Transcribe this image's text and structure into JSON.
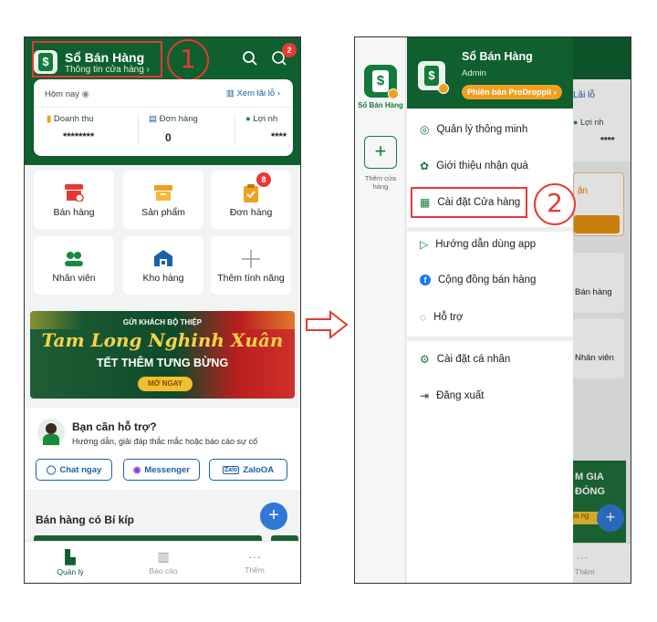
{
  "screen1": {
    "header": {
      "app_name": "Sổ Bán Hàng",
      "store_info": "Thông tin cửa hàng",
      "chat_badge": "2",
      "step": "1"
    },
    "summary": {
      "today": "Hôm nay",
      "view_profit": "Xem lãi lỗ",
      "stats": [
        {
          "label": "Doanh thu",
          "value": "********"
        },
        {
          "label": "Đơn hàng",
          "value": "0"
        },
        {
          "label": "Lợi nh",
          "value": "****"
        }
      ]
    },
    "features": [
      {
        "label": "Bán hàng",
        "icon": "store-icon"
      },
      {
        "label": "Sản phẩm",
        "icon": "box-icon"
      },
      {
        "label": "Đơn hàng",
        "icon": "clipboard-icon",
        "badge": "8"
      },
      {
        "label": "Nhân viên",
        "icon": "staff-icon"
      },
      {
        "label": "Kho hàng",
        "icon": "warehouse-icon"
      },
      {
        "label": "Thêm tính năng",
        "icon": "plus-icon"
      }
    ],
    "banner": {
      "top": "GỬI KHÁCH BỘ THIỆP",
      "script": "Tam Long Nghinh Xuân",
      "sub": "TẾT THÊM TƯNG BỪNG",
      "cta": "MỞ NGAY"
    },
    "support": {
      "title": "Bạn cần hỗ trợ?",
      "desc": "Hướng dẫn, giải đáp thắc mắc hoặc báo cáo sự cố",
      "buttons": [
        "Chat ngay",
        "Messenger",
        "ZaloOA"
      ]
    },
    "tips_title": "Bán hàng có Bí kíp",
    "nav": [
      "Quản lý",
      "Báo cáo",
      "Thêm"
    ]
  },
  "screen2": {
    "rail": {
      "store_label": "Sổ Bán Hàng",
      "add_label": "Thêm cửa hàng"
    },
    "drawer": {
      "name": "Sổ Bán Hàng",
      "role": "Admin",
      "version": "Phiên bản ProDroppii",
      "step": "2",
      "items": [
        {
          "label": "Quản lý thông minh",
          "icon": "smart-icon"
        },
        {
          "label": "Giới thiệu nhận quà",
          "icon": "gift-icon"
        },
        {
          "label": "Cài đặt Cửa hàng",
          "icon": "store-settings-icon"
        },
        {
          "label": "Hướng dẫn dùng app",
          "icon": "play-icon"
        },
        {
          "label": "Cộng đồng bán hàng",
          "icon": "facebook-icon"
        },
        {
          "label": "Hỗ trợ",
          "icon": "chat-icon"
        },
        {
          "label": "Cài đặt cá nhân",
          "icon": "gear-icon"
        },
        {
          "label": "Đăng xuất",
          "icon": "logout-icon"
        }
      ]
    },
    "peek": {
      "profit": "Lãi lỗ",
      "profit_short": "Lợi nh",
      "value": "****",
      "ban": "ận",
      "sell": "Bán hàng",
      "staff": "Nhân viên",
      "promo1": "M GIA",
      "promo2": "ĐÓNG",
      "promo3": "ia ng",
      "nav": "Thêm"
    }
  },
  "colors": {
    "brand": "#0f5f2f",
    "accent": "#e53935",
    "link": "#1d5fa8",
    "fab": "#2f78d6"
  }
}
